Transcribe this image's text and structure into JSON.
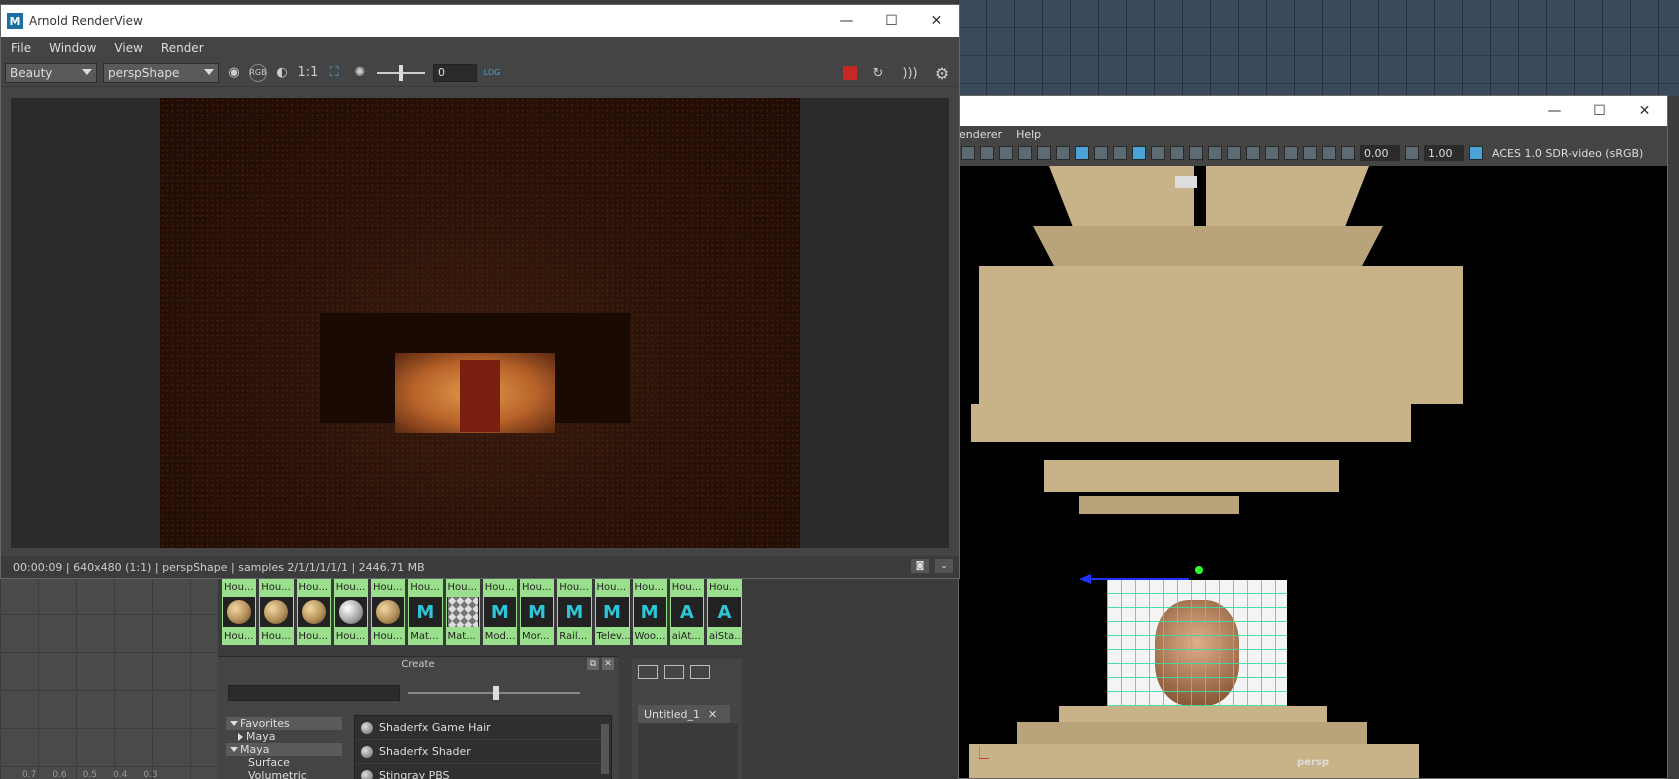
{
  "arnold": {
    "title": "Arnold RenderView",
    "menu": [
      "File",
      "Window",
      "View",
      "Render"
    ],
    "aov_select": "Beauty",
    "camera_select": "perspShape",
    "ratio_label": "1:1",
    "rgb_label": "RGB",
    "exposure_value": "0",
    "log_label": "LOG",
    "status": "00:00:09 | 640x480 (1:1) | perspShape  | samples 2/1/1/1/1/1 | 2446.71 MB"
  },
  "viewport": {
    "menu": [
      "enderer",
      "Help"
    ],
    "exposure": "0.00",
    "gamma": "1.00",
    "color_transform": "ACES 1.0 SDR-video (sRGB)",
    "camera_label": "persp"
  },
  "swatches": [
    {
      "label": "Hou...",
      "sub": "Hou...",
      "kind": "ball"
    },
    {
      "label": "Hou...",
      "sub": "Hou...",
      "kind": "ball"
    },
    {
      "label": "Hou...",
      "sub": "Hou...",
      "kind": "ball"
    },
    {
      "label": "Hou...",
      "sub": "Hou...",
      "kind": "grey"
    },
    {
      "label": "Hou...",
      "sub": "Hou...",
      "kind": "ball"
    },
    {
      "label": "Hou...",
      "sub": "Mat...",
      "kind": "m"
    },
    {
      "label": "Hou...",
      "sub": "Mat...",
      "kind": "checker"
    },
    {
      "label": "Hou...",
      "sub": "Mod...",
      "kind": "m"
    },
    {
      "label": "Hou...",
      "sub": "Mor...",
      "kind": "m"
    },
    {
      "label": "Hou...",
      "sub": "Rail...",
      "kind": "m"
    },
    {
      "label": "Hou...",
      "sub": "Telev...",
      "kind": "m"
    },
    {
      "label": "Hou...",
      "sub": "Woo...",
      "kind": "m"
    },
    {
      "label": "Hou...",
      "sub": "aiAt...",
      "kind": "a"
    },
    {
      "label": "Hou...",
      "sub": "aiSta...",
      "kind": "a"
    }
  ],
  "create_panel": {
    "title": "Create",
    "tree": [
      "Favorites",
      "Maya",
      "Maya",
      "Surface",
      "Volumetric"
    ],
    "shaders": [
      "Shaderfx Game Hair",
      "Shaderfx Shader",
      "Stingray PBS"
    ]
  },
  "tabs": {
    "untitled": "Untitled_1"
  },
  "bg_ticks": [
    "0.7",
    "0.6",
    "0.5",
    "0.4",
    "0.3"
  ]
}
